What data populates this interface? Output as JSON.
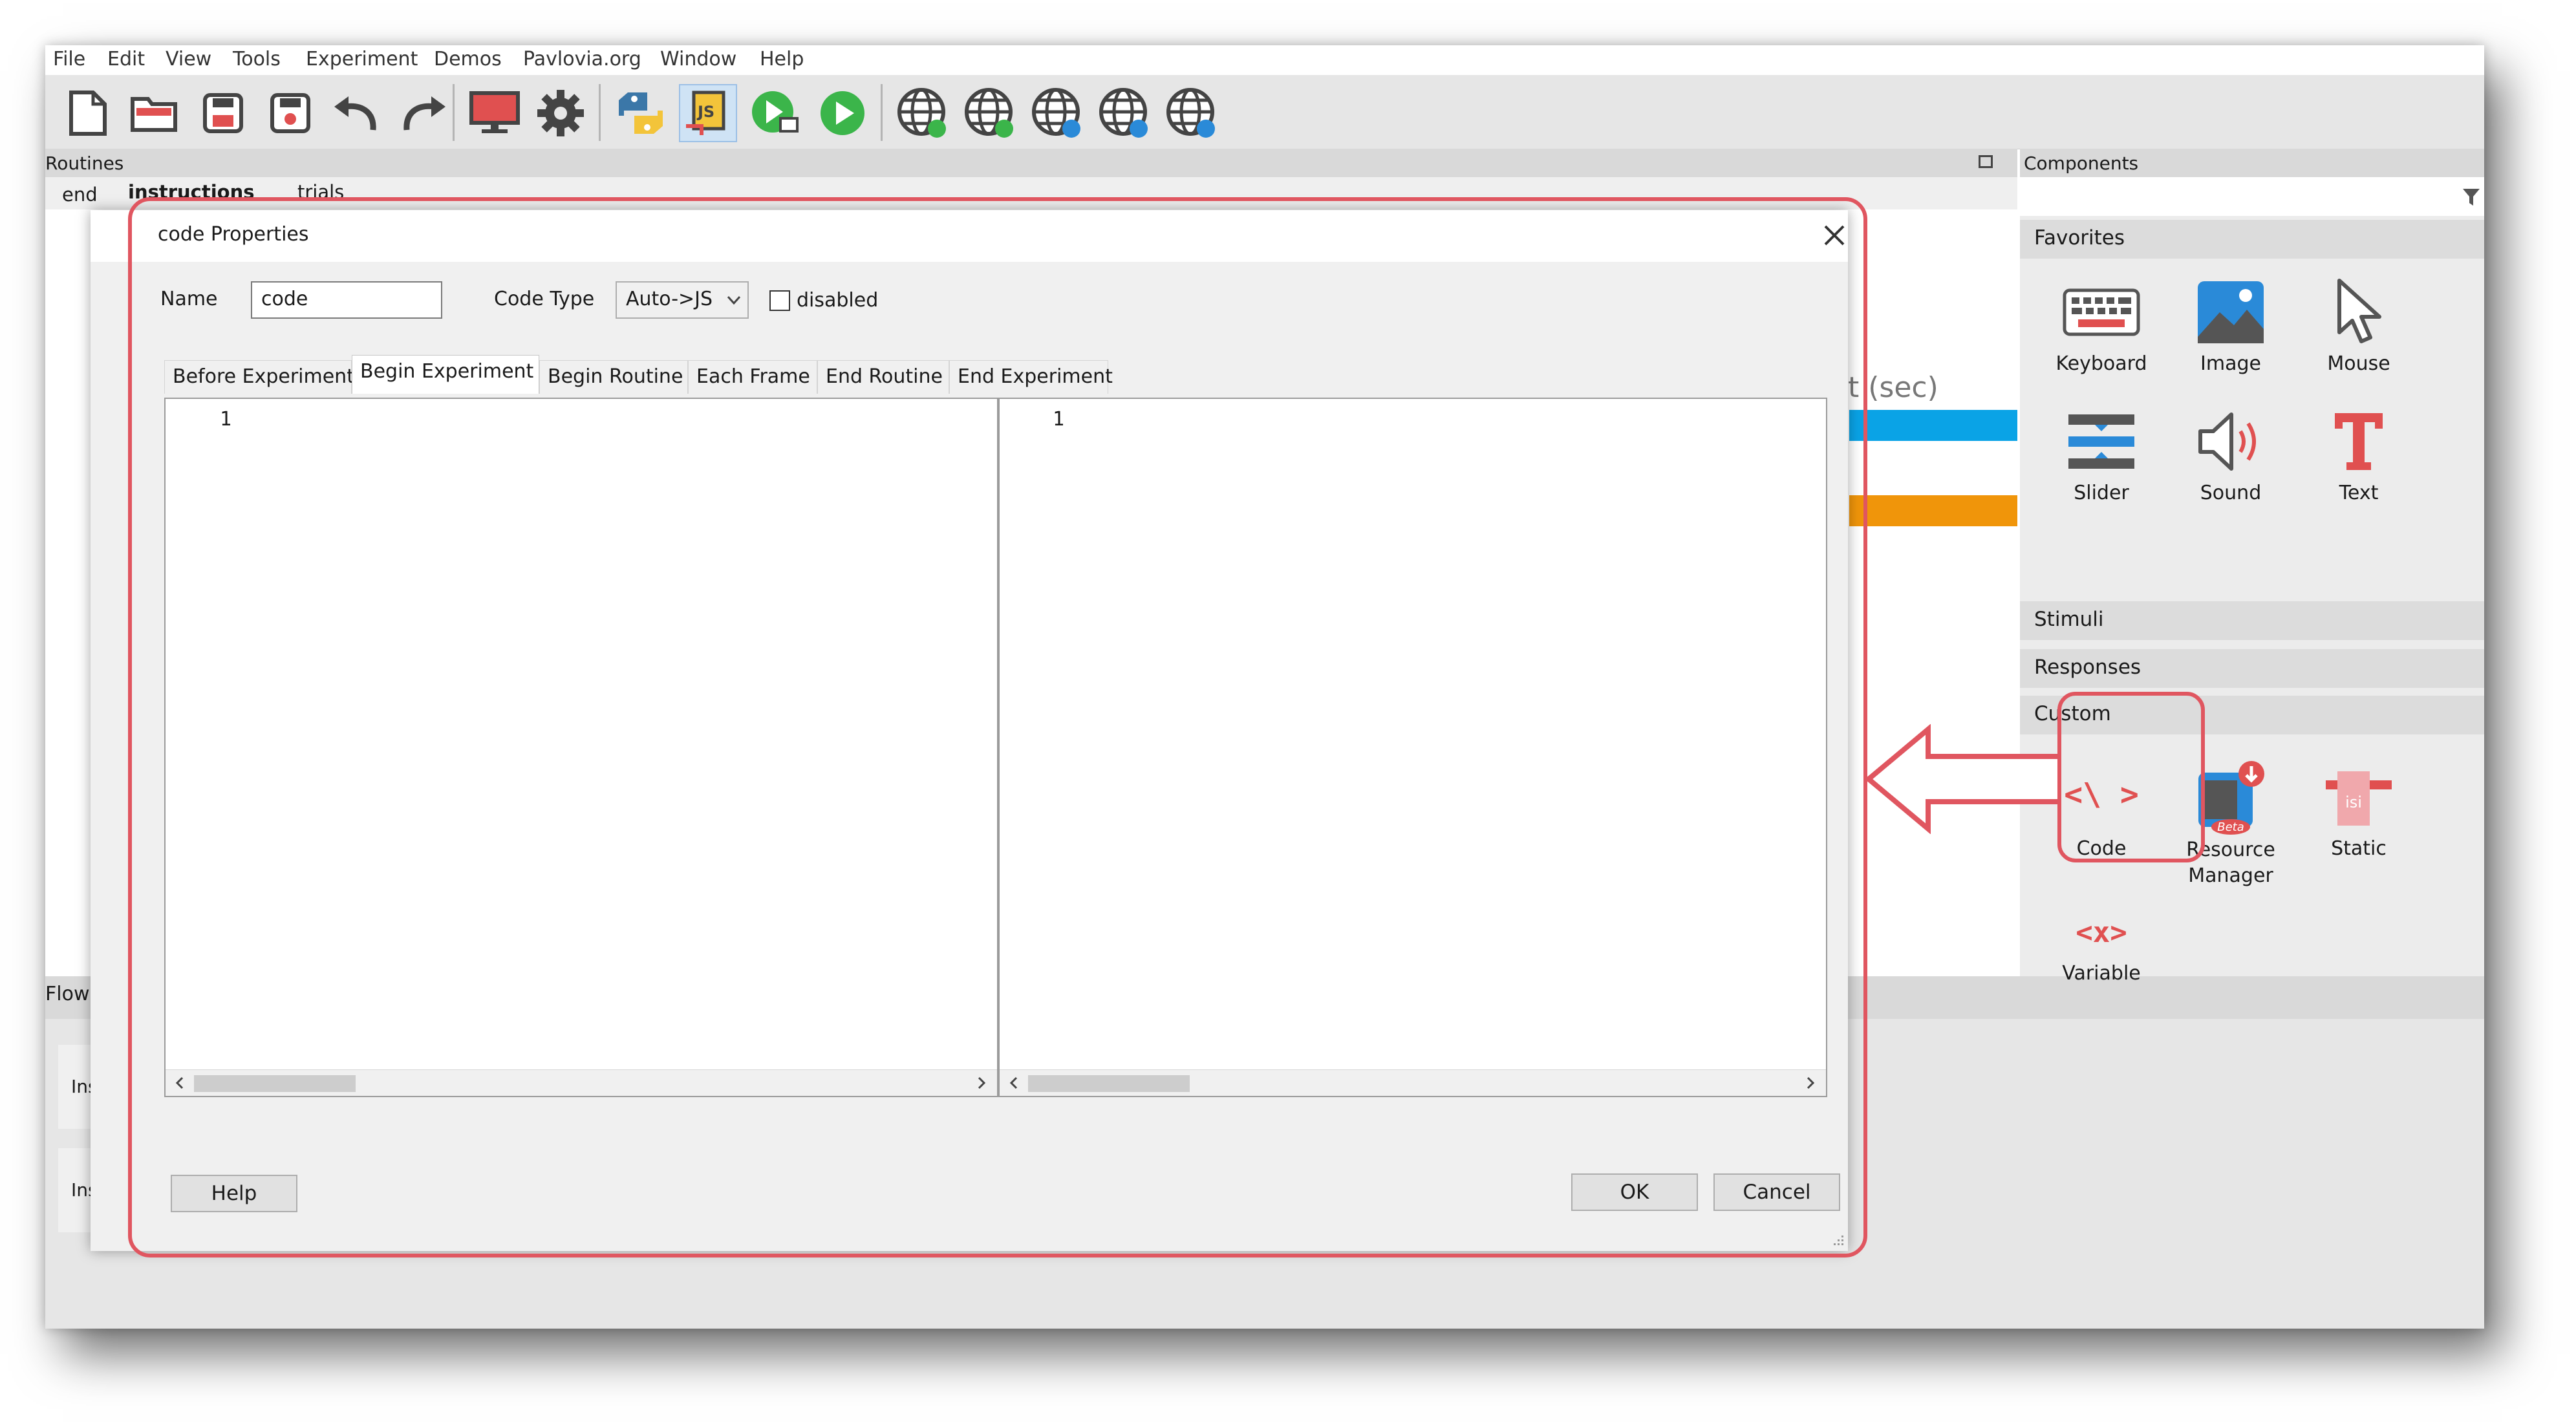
{
  "menu": [
    "File",
    "Edit",
    "View",
    "Tools",
    "Experiment",
    "Demos",
    "Pavlovia.org",
    "Window",
    "Help"
  ],
  "toolbar": {
    "icons": [
      "new-file-icon",
      "open-folder-icon",
      "save-icon",
      "save-as-icon",
      "undo-icon",
      "redo-icon",
      "monitor-icon",
      "gear-icon",
      "python-icon",
      "javascript-icon",
      "run-pilot-icon",
      "run-icon",
      "globe-run-icon",
      "globe-sync-icon",
      "globe-search-icon",
      "globe-user-icon",
      "globe-info-icon"
    ],
    "js_label": "JS"
  },
  "routines": {
    "header": "Routines",
    "tabs": [
      "end",
      "instructions",
      "trials"
    ],
    "timeline_label": "t (sec)",
    "colors": {
      "blue": "#0aa3e6",
      "orange": "#f0950a"
    }
  },
  "flow": {
    "header": "Flow",
    "insert_routine": "Insert R",
    "insert_loop": "Insert L"
  },
  "components": {
    "header": "Components",
    "favorites_label": "Favorites",
    "favorites": [
      {
        "label": "Keyboard",
        "icon": "keyboard-icon"
      },
      {
        "label": "Image",
        "icon": "image-icon"
      },
      {
        "label": "Mouse",
        "icon": "mouse-cursor-icon"
      },
      {
        "label": "Slider",
        "icon": "slider-icon"
      },
      {
        "label": "Sound",
        "icon": "speaker-icon"
      },
      {
        "label": "Text",
        "icon": "text-T-icon"
      }
    ],
    "categories": [
      "Stimuli",
      "Responses",
      "Custom"
    ],
    "custom": [
      {
        "label": "Code",
        "icon": "code-icon",
        "glyph": "<\\ >"
      },
      {
        "label": "Resource Manager",
        "icon": "resource-manager-icon",
        "badge": "Beta"
      },
      {
        "label": "Static",
        "icon": "static-icon",
        "glyph": "isi"
      },
      {
        "label": "Variable",
        "icon": "variable-icon",
        "glyph": "<x>"
      }
    ]
  },
  "dialog": {
    "title": "code Properties",
    "name_label": "Name",
    "name_value": "code",
    "code_type_label": "Code Type",
    "code_type_value": "Auto->JS",
    "disabled_label": "disabled",
    "tabs": [
      "Before Experiment",
      "Begin Experiment",
      "Begin Routine",
      "Each Frame",
      "End Routine",
      "End Experiment"
    ],
    "active_tab": "Begin Experiment",
    "left_line": "1",
    "right_line": "1",
    "help": "Help",
    "ok": "OK",
    "cancel": "Cancel"
  },
  "annotation_color": "#e05660"
}
